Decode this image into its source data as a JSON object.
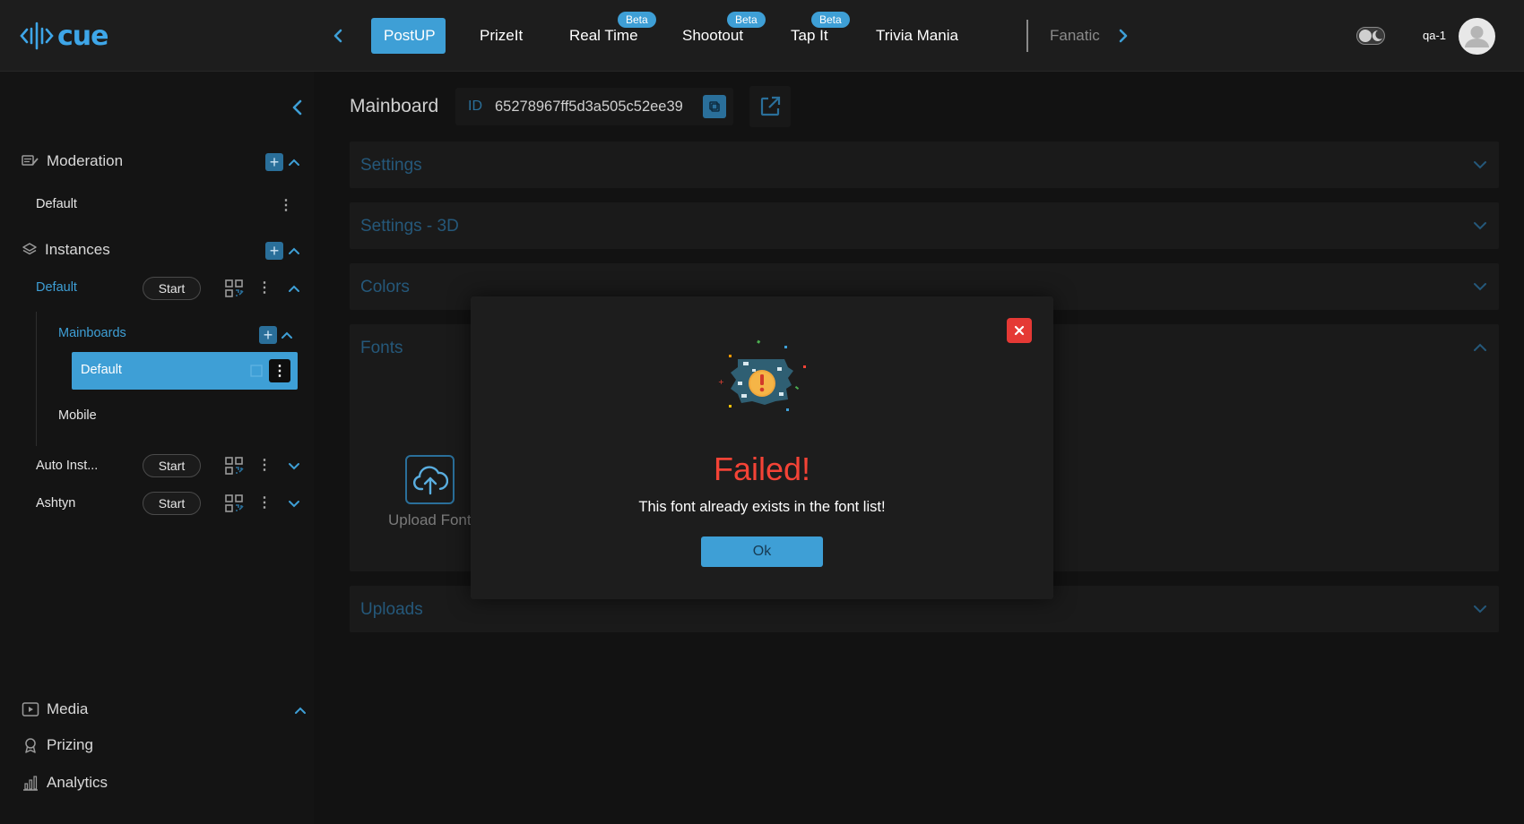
{
  "topbar": {
    "logo_text": "cue",
    "tabs": [
      {
        "label": "PostUP",
        "active": true,
        "beta": ""
      },
      {
        "label": "PrizeIt",
        "active": false,
        "beta": ""
      },
      {
        "label": "Real Time",
        "active": false,
        "beta": "Beta"
      },
      {
        "label": "Shootout",
        "active": false,
        "beta": "Beta"
      },
      {
        "label": "Tap It",
        "active": false,
        "beta": "Beta"
      },
      {
        "label": "Trivia Mania",
        "active": false,
        "beta": ""
      },
      {
        "label": "Fanatic",
        "active": false,
        "beta": ""
      }
    ],
    "user_name": "qa-1"
  },
  "sidebar": {
    "moderation": {
      "label": "Moderation",
      "items": [
        "Default"
      ]
    },
    "instances": {
      "label": "Instances",
      "items": [
        {
          "label": "Default",
          "start_label": "Start"
        },
        {
          "label": "Auto Inst...",
          "start_label": "Start"
        },
        {
          "label": "Ashtyn",
          "start_label": "Start"
        }
      ],
      "mainboards_label": "Mainboards",
      "mainboard_items": [
        "Default",
        "Mobile"
      ]
    },
    "bottom": [
      "Media",
      "Prizing",
      "Analytics"
    ]
  },
  "main": {
    "title": "Mainboard",
    "id_label": "ID",
    "id_value": "65278967ff5d3a505c52ee39",
    "sections": [
      "Settings",
      "Settings - 3D",
      "Colors",
      "Fonts",
      "Uploads"
    ],
    "upload_font_label": "Upload Font"
  },
  "modal": {
    "title": "Failed!",
    "message": "This font already exists in the font list!",
    "ok_label": "Ok"
  },
  "colors": {
    "accent": "#3e9fd6",
    "error": "#f44336",
    "background": "#121212"
  }
}
